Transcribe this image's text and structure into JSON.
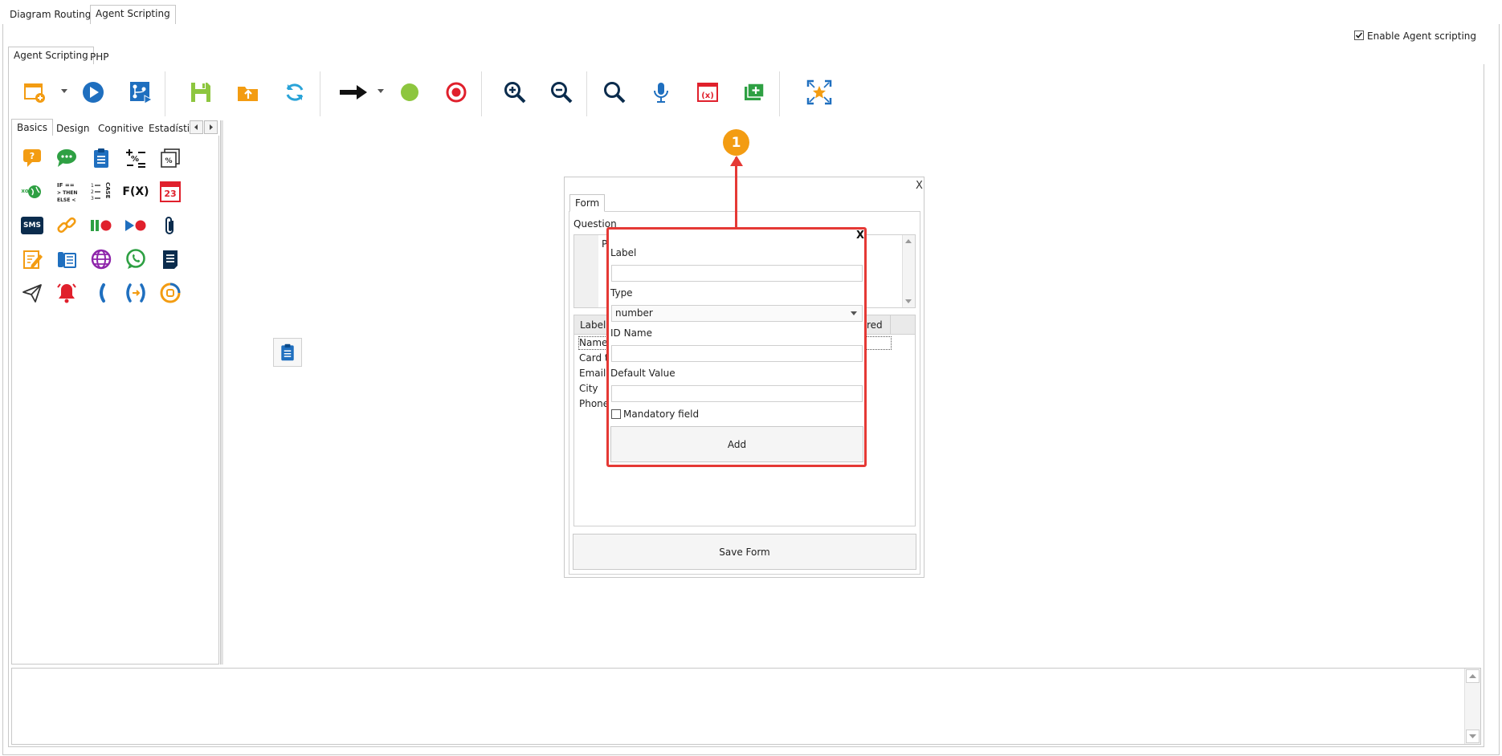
{
  "top_tabs": [
    "Diagram Routing",
    "Agent Scripting"
  ],
  "enable_checkbox": {
    "label": "Enable Agent scripting",
    "checked": true
  },
  "sub_tabs": [
    "Agent Scripting",
    "PHP"
  ],
  "toolbar": {
    "icons": [
      "new-diagram-icon",
      "dropdown-icon",
      "play-icon",
      "flow-run-icon",
      "save-icon",
      "open-folder-icon",
      "refresh-icon",
      "arrow-connector-icon",
      "dropdown-icon",
      "start-node-icon",
      "end-node-icon",
      "zoom-in-icon",
      "zoom-out-icon",
      "search-icon",
      "microphone-icon",
      "variable-icon",
      "add-folder-icon",
      "fit-screen-icon"
    ]
  },
  "palette": {
    "tabs": [
      "Basics",
      "Design",
      "Cognitive",
      "Estadísti"
    ],
    "fx_label": "F(X)",
    "calendar_day": "23",
    "sms_label": "SMS",
    "ifthen_label": "IF == > THEN ELSE <",
    "case_label": "CASE"
  },
  "form_dialog": {
    "close": "X",
    "tab": "Form",
    "question_label": "Question",
    "question_value": "P",
    "table_headers": [
      "Label",
      "red"
    ],
    "rows": [
      "Name",
      "Card t",
      "Email",
      "City",
      "Phone"
    ],
    "save_button": "Save Form"
  },
  "add_field_popup": {
    "close": "X",
    "label_label": "Label",
    "label_value": "",
    "type_label": "Type",
    "type_value": "number",
    "idname_label": "ID Name",
    "idname_value": "",
    "default_label": "Default Value",
    "default_value": "",
    "mandatory_label": "Mandatory field",
    "mandatory_checked": false,
    "add_button": "Add"
  },
  "callout": {
    "number": "1",
    "color": "#f39c12",
    "line_color": "#e53935"
  }
}
